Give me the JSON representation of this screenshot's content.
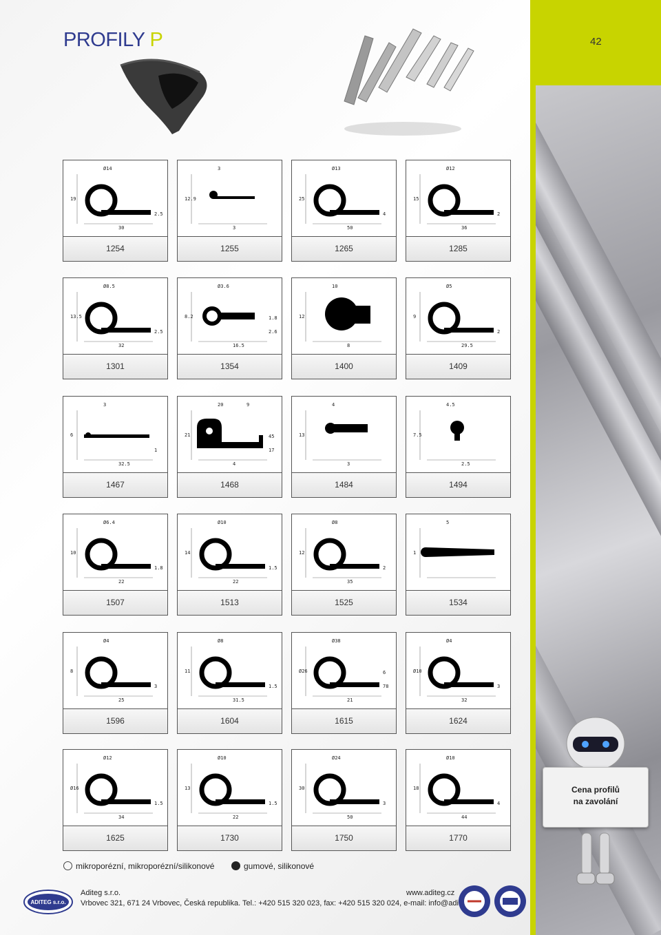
{
  "header": {
    "title_main": "PROFILY",
    "title_accent": "P",
    "page_number": "42"
  },
  "colors": {
    "brand_blue": "#2f3b8f",
    "accent_green": "#c8d400"
  },
  "profiles": [
    {
      "code": "1254",
      "dims": [
        "Ø14",
        "19",
        "30",
        "2.5"
      ]
    },
    {
      "code": "1255",
      "dims": [
        "3",
        "12.9",
        "3"
      ]
    },
    {
      "code": "1265",
      "dims": [
        "Ø13",
        "25",
        "50",
        "4"
      ]
    },
    {
      "code": "1285",
      "dims": [
        "Ø12",
        "15",
        "36",
        "2"
      ]
    },
    {
      "code": "1301",
      "dims": [
        "Ø8.5",
        "13.5",
        "32",
        "2.5"
      ]
    },
    {
      "code": "1354",
      "dims": [
        "Ø3.6",
        "8.2",
        "16.5",
        "2.6",
        "1.8"
      ]
    },
    {
      "code": "1400",
      "dims": [
        "10",
        "12",
        "8"
      ]
    },
    {
      "code": "1409",
      "dims": [
        "Ø5",
        "9",
        "29.5",
        "2"
      ]
    },
    {
      "code": "1467",
      "dims": [
        "3",
        "6",
        "32.5",
        "1"
      ]
    },
    {
      "code": "1468",
      "dims": [
        "20",
        "21",
        "4",
        "17",
        "45",
        "9"
      ]
    },
    {
      "code": "1484",
      "dims": [
        "4",
        "13",
        "3"
      ]
    },
    {
      "code": "1494",
      "dims": [
        "4.5",
        "7.5",
        "2.5"
      ]
    },
    {
      "code": "1507",
      "dims": [
        "Ø6.4",
        "10",
        "22",
        "1.8"
      ]
    },
    {
      "code": "1513",
      "dims": [
        "Ø10",
        "14",
        "22",
        "1.5"
      ]
    },
    {
      "code": "1525",
      "dims": [
        "Ø8",
        "12",
        "35",
        "2"
      ]
    },
    {
      "code": "1534",
      "dims": [
        "5",
        "1"
      ]
    },
    {
      "code": "1596",
      "dims": [
        "Ø4",
        "8",
        "25",
        "3"
      ]
    },
    {
      "code": "1604",
      "dims": [
        "Ø8",
        "11",
        "31.5",
        "1.5"
      ]
    },
    {
      "code": "1615",
      "dims": [
        "Ø38",
        "Ø26",
        "21",
        "78",
        "6"
      ]
    },
    {
      "code": "1624",
      "dims": [
        "Ø4",
        "Ø10",
        "32",
        "3"
      ]
    },
    {
      "code": "1625",
      "dims": [
        "Ø12",
        "Ø16",
        "34",
        "1.5"
      ]
    },
    {
      "code": "1730",
      "dims": [
        "Ø10",
        "13",
        "22",
        "1.5"
      ]
    },
    {
      "code": "1750",
      "dims": [
        "Ø24",
        "30",
        "50",
        "3"
      ]
    },
    {
      "code": "1770",
      "dims": [
        "Ø10",
        "18",
        "44",
        "4"
      ]
    }
  ],
  "legend": {
    "microporous": "mikroporézní, mikroporézní/silikonové",
    "rubber": "gumové, silikonové"
  },
  "footer": {
    "company": "Aditeg s.r.o.",
    "address": "Vrbovec 321, 671 24  Vrbovec, Česká republika. Tel.: +420 515 320 023, fax: +420 515 320 024, e-mail: info@aditeg.cz",
    "website": "www.aditeg.cz",
    "logo_text": "ADITEG s.r.o."
  },
  "promo": {
    "line1": "Cena profilů",
    "line2": "na zavolání"
  }
}
